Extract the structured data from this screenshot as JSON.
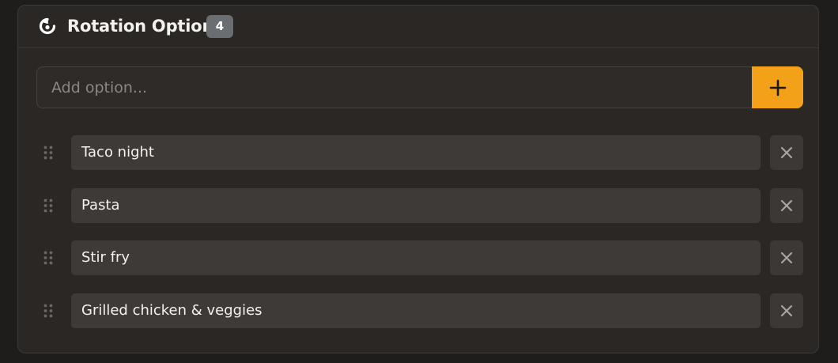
{
  "header": {
    "title": "Rotation Options",
    "count": "4",
    "icon": "rotation-icon"
  },
  "add": {
    "placeholder": "Add option...",
    "value": "",
    "button_icon": "plus-icon"
  },
  "options": [
    {
      "label": "Taco night"
    },
    {
      "label": "Pasta"
    },
    {
      "label": "Stir fry"
    },
    {
      "label": "Grilled chicken & veggies"
    }
  ],
  "colors": {
    "accent": "#f4a11a",
    "panel": "#2a2725",
    "field": "#3e3a37",
    "badge": "#6a6e73"
  }
}
